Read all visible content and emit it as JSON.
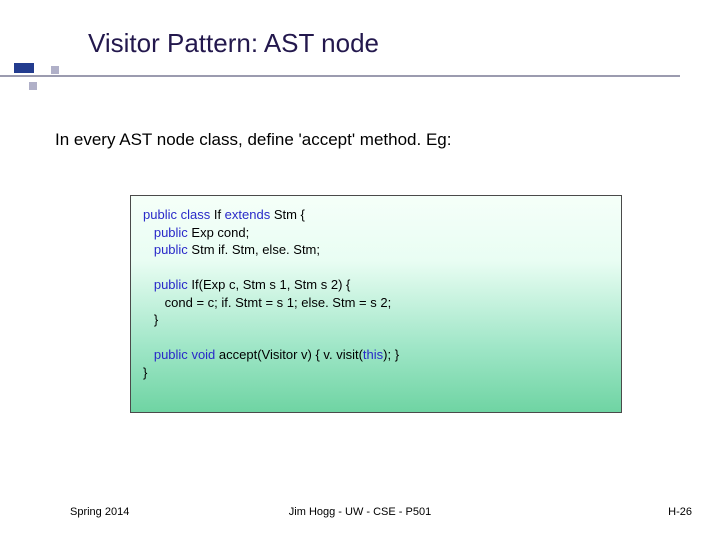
{
  "title": "Visitor Pattern: AST node",
  "intro": "In every AST node class, define 'accept' method.  Eg:",
  "code": {
    "kw_public": "public",
    "kw_class": "class",
    "kw_extends": "extends",
    "kw_void": "void",
    "l1_a": " If ",
    "l1_b": " Stm {",
    "l2": " Exp cond;",
    "l3": " Stm if. Stm, else. Stm;",
    "l5": " If(Exp c, Stm s 1, Stm s 2) {",
    "l6": "      cond = c; if. Stmt = s 1; else. Stm = s 2;",
    "l7": "   }",
    "l9_b": " accept(Visitor v) { v. visit(",
    "kw_this": "this",
    "l9_c": "); }",
    "l10": "}"
  },
  "footer": {
    "left": "Spring 2014",
    "center": "Jim Hogg - UW - CSE - P501",
    "right": "H-26"
  }
}
